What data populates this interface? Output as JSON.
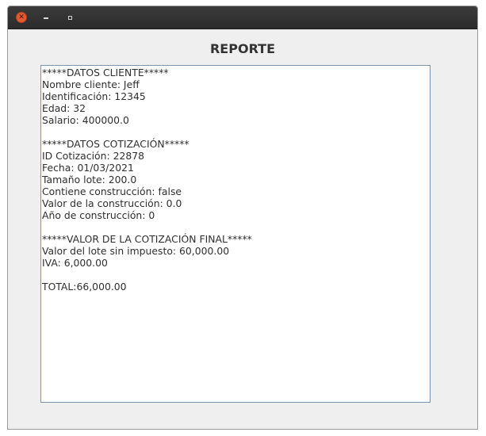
{
  "window": {
    "controls": {
      "close_icon": "close-icon",
      "minimize_icon": "minimize-icon",
      "maximize_icon": "maximize-icon",
      "close_color": "#e35a32"
    }
  },
  "heading": "REPORTE",
  "report": {
    "lines": [
      "*****DATOS CLIENTE*****",
      "Nombre cliente: Jeff",
      "Identificación: 12345",
      "Edad: 32",
      "Salario: 400000.0",
      "",
      "*****DATOS COTIZACIÓN*****",
      "ID Cotización: 22878",
      "Fecha: 01/03/2021",
      "Tamaño lote: 200.0",
      "Contiene construcción: false",
      "Valor de la construcción: 0.0",
      "Año de construcción: 0",
      "",
      "*****VALOR DE LA COTIZACIÓN FINAL*****",
      "Valor del lote sin impuesto: 60,000.00",
      "IVA: 6,000.00",
      "",
      "TOTAL:66,000.00"
    ]
  }
}
